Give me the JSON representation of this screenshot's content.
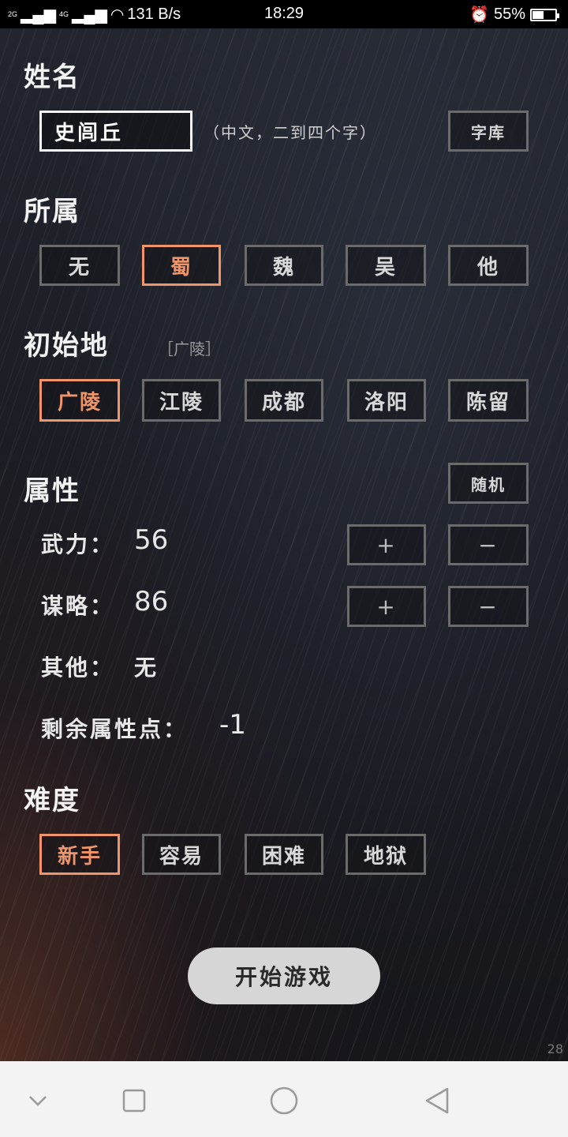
{
  "status_bar": {
    "signal1": "2G",
    "signal2": "4G",
    "speed": "131 B/s",
    "time": "18:29",
    "battery_percent": "55%",
    "battery_level": 0.55
  },
  "name_section": {
    "title": "姓名",
    "name_value": "史闾丘",
    "hint": "（中文，二到四个字）",
    "library_button": "字库"
  },
  "faction_section": {
    "title": "所属",
    "options": [
      "无",
      "蜀",
      "魏",
      "吴",
      "他"
    ],
    "selected": "蜀"
  },
  "origin_section": {
    "title": "初始地",
    "current_note": "［广陵］",
    "options": [
      "广陵",
      "江陵",
      "成都",
      "洛阳",
      "陈留"
    ],
    "selected": "广陵"
  },
  "attribute_section": {
    "title": "属性",
    "random_button": "随机",
    "force_label": "武力：",
    "force_value": "56",
    "strategy_label": "谋略：",
    "strategy_value": "86",
    "other_label": "其他：",
    "other_value": "无",
    "remaining_label": "剩余属性点：",
    "remaining_value": "-1",
    "plus": "+",
    "minus": "−"
  },
  "difficulty_section": {
    "title": "难度",
    "options": [
      "新手",
      "容易",
      "困难",
      "地狱"
    ],
    "selected": "新手"
  },
  "start_button": "开始游戏",
  "fps_counter": "28",
  "colors": {
    "accent": "#f0956a",
    "button_border": "#6b6b6b",
    "start_button_bg": "#d6d6d6"
  }
}
